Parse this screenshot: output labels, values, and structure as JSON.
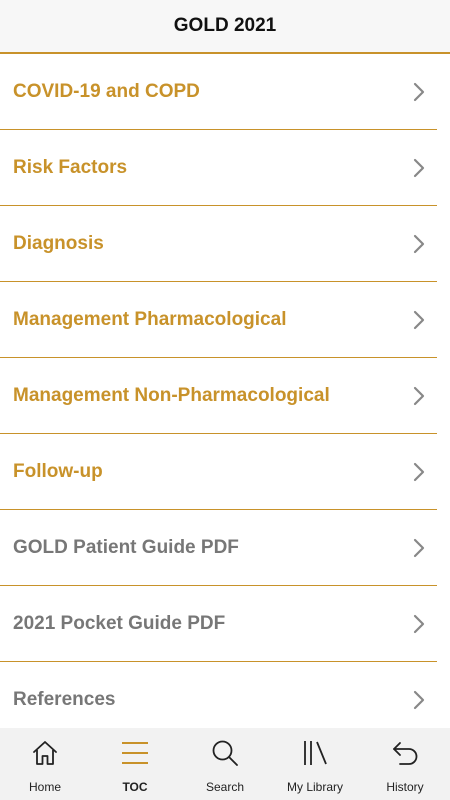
{
  "header": {
    "title": "GOLD 2021"
  },
  "toc": {
    "items": [
      {
        "label": "COVID-19 and COPD"
      },
      {
        "label": "Risk Factors"
      },
      {
        "label": "Diagnosis"
      },
      {
        "label": "Management Pharmacological"
      },
      {
        "label": "Management Non-Pharmacological"
      },
      {
        "label": "Follow-up"
      },
      {
        "label": "GOLD Patient Guide PDF"
      },
      {
        "label": "2021 Pocket Guide PDF"
      },
      {
        "label": "References"
      }
    ]
  },
  "tabbar": {
    "tabs": [
      {
        "label": "Home",
        "icon": "home-icon"
      },
      {
        "label": "TOC",
        "icon": "menu-icon",
        "active": true
      },
      {
        "label": "Search",
        "icon": "search-icon"
      },
      {
        "label": "My Library",
        "icon": "library-icon"
      },
      {
        "label": "History",
        "icon": "undo-arrow-icon"
      }
    ]
  },
  "colors": {
    "accent": "#c8922a",
    "secondary_text": "#777777",
    "tabbar_bg": "#f2f2f2",
    "header_bg": "#f7f7f7"
  }
}
